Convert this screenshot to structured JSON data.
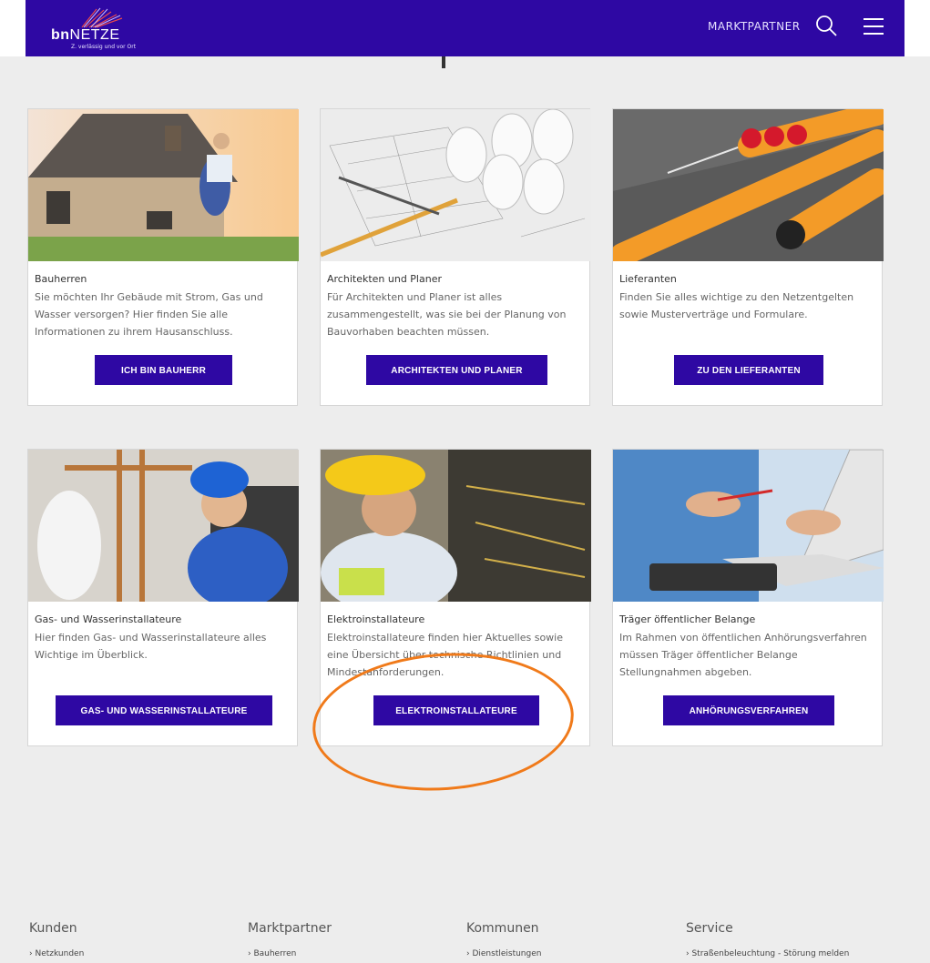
{
  "header": {
    "logo_text_bold": "bn",
    "logo_text_light": "NETZE",
    "logo_tagline": "Z. verlässig und vor Ort",
    "nav_link": "MARKTPARTNER"
  },
  "colors": {
    "brand": "#2e08a3",
    "annotation": "#f07a1a",
    "background": "#ededed"
  },
  "icons": [
    "search-icon",
    "menu-icon"
  ],
  "cards": [
    {
      "title": "Bauherren",
      "text": "Sie möchten Ihr Gebäude mit Strom, Gas und Wasser versorgen? Hier finden Sie alle Informationen zu ihrem Hausanschluss.",
      "button": "ICH BIN BAUHERR"
    },
    {
      "title": "Architekten und Planer",
      "text": "Für Architekten und Planer ist alles zusammengestellt, was sie bei der Planung von Bauvorhaben beachten müssen.",
      "button": "ARCHITEKTEN UND PLANER"
    },
    {
      "title": "Lieferanten",
      "text": "Finden Sie alles wichtige zu den Netzentgelten sowie Musterverträge und Formulare.",
      "button": "ZU DEN LIEFERANTEN"
    },
    {
      "title": "Gas- und Wasserinstallateure",
      "text": "Hier finden Gas- und Wasserinstallateure alles Wichtige im Überblick.",
      "button": "GAS- UND WASSERINSTALLATEURE"
    },
    {
      "title": "Elektroinstallateure",
      "text": "Elektroinstallateure finden hier Aktuelles sowie eine Übersicht über technische Richtlinien und Mindestanforderungen.",
      "button": "ELEKTROINSTALLATEURE"
    },
    {
      "title": "Träger öffentlicher Belange",
      "text": "Im Rahmen von öffentlichen Anhörungsverfahren müssen Träger öffentlicher Belange Stellungnahmen abgeben.",
      "button": "ANHÖRUNGSVERFAHREN"
    }
  ],
  "footer": {
    "columns": [
      {
        "heading": "Kunden",
        "link": "› Netzkunden"
      },
      {
        "heading": "Marktpartner",
        "link": "› Bauherren"
      },
      {
        "heading": "Kommunen",
        "link": "› Dienstleistungen"
      },
      {
        "heading": "Service",
        "link": "› Straßenbeleuchtung - Störung melden"
      }
    ]
  }
}
